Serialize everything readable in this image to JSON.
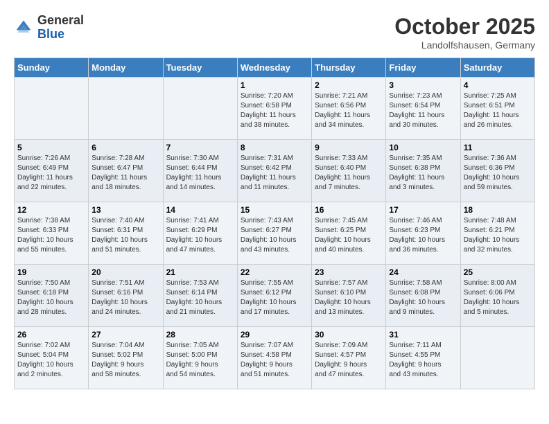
{
  "logo": {
    "general": "General",
    "blue": "Blue"
  },
  "header": {
    "month": "October 2025",
    "location": "Landolfshausen, Germany"
  },
  "weekdays": [
    "Sunday",
    "Monday",
    "Tuesday",
    "Wednesday",
    "Thursday",
    "Friday",
    "Saturday"
  ],
  "weeks": [
    [
      {
        "day": "",
        "info": ""
      },
      {
        "day": "",
        "info": ""
      },
      {
        "day": "",
        "info": ""
      },
      {
        "day": "1",
        "info": "Sunrise: 7:20 AM\nSunset: 6:58 PM\nDaylight: 11 hours\nand 38 minutes."
      },
      {
        "day": "2",
        "info": "Sunrise: 7:21 AM\nSunset: 6:56 PM\nDaylight: 11 hours\nand 34 minutes."
      },
      {
        "day": "3",
        "info": "Sunrise: 7:23 AM\nSunset: 6:54 PM\nDaylight: 11 hours\nand 30 minutes."
      },
      {
        "day": "4",
        "info": "Sunrise: 7:25 AM\nSunset: 6:51 PM\nDaylight: 11 hours\nand 26 minutes."
      }
    ],
    [
      {
        "day": "5",
        "info": "Sunrise: 7:26 AM\nSunset: 6:49 PM\nDaylight: 11 hours\nand 22 minutes."
      },
      {
        "day": "6",
        "info": "Sunrise: 7:28 AM\nSunset: 6:47 PM\nDaylight: 11 hours\nand 18 minutes."
      },
      {
        "day": "7",
        "info": "Sunrise: 7:30 AM\nSunset: 6:44 PM\nDaylight: 11 hours\nand 14 minutes."
      },
      {
        "day": "8",
        "info": "Sunrise: 7:31 AM\nSunset: 6:42 PM\nDaylight: 11 hours\nand 11 minutes."
      },
      {
        "day": "9",
        "info": "Sunrise: 7:33 AM\nSunset: 6:40 PM\nDaylight: 11 hours\nand 7 minutes."
      },
      {
        "day": "10",
        "info": "Sunrise: 7:35 AM\nSunset: 6:38 PM\nDaylight: 11 hours\nand 3 minutes."
      },
      {
        "day": "11",
        "info": "Sunrise: 7:36 AM\nSunset: 6:36 PM\nDaylight: 10 hours\nand 59 minutes."
      }
    ],
    [
      {
        "day": "12",
        "info": "Sunrise: 7:38 AM\nSunset: 6:33 PM\nDaylight: 10 hours\nand 55 minutes."
      },
      {
        "day": "13",
        "info": "Sunrise: 7:40 AM\nSunset: 6:31 PM\nDaylight: 10 hours\nand 51 minutes."
      },
      {
        "day": "14",
        "info": "Sunrise: 7:41 AM\nSunset: 6:29 PM\nDaylight: 10 hours\nand 47 minutes."
      },
      {
        "day": "15",
        "info": "Sunrise: 7:43 AM\nSunset: 6:27 PM\nDaylight: 10 hours\nand 43 minutes."
      },
      {
        "day": "16",
        "info": "Sunrise: 7:45 AM\nSunset: 6:25 PM\nDaylight: 10 hours\nand 40 minutes."
      },
      {
        "day": "17",
        "info": "Sunrise: 7:46 AM\nSunset: 6:23 PM\nDaylight: 10 hours\nand 36 minutes."
      },
      {
        "day": "18",
        "info": "Sunrise: 7:48 AM\nSunset: 6:21 PM\nDaylight: 10 hours\nand 32 minutes."
      }
    ],
    [
      {
        "day": "19",
        "info": "Sunrise: 7:50 AM\nSunset: 6:18 PM\nDaylight: 10 hours\nand 28 minutes."
      },
      {
        "day": "20",
        "info": "Sunrise: 7:51 AM\nSunset: 6:16 PM\nDaylight: 10 hours\nand 24 minutes."
      },
      {
        "day": "21",
        "info": "Sunrise: 7:53 AM\nSunset: 6:14 PM\nDaylight: 10 hours\nand 21 minutes."
      },
      {
        "day": "22",
        "info": "Sunrise: 7:55 AM\nSunset: 6:12 PM\nDaylight: 10 hours\nand 17 minutes."
      },
      {
        "day": "23",
        "info": "Sunrise: 7:57 AM\nSunset: 6:10 PM\nDaylight: 10 hours\nand 13 minutes."
      },
      {
        "day": "24",
        "info": "Sunrise: 7:58 AM\nSunset: 6:08 PM\nDaylight: 10 hours\nand 9 minutes."
      },
      {
        "day": "25",
        "info": "Sunrise: 8:00 AM\nSunset: 6:06 PM\nDaylight: 10 hours\nand 5 minutes."
      }
    ],
    [
      {
        "day": "26",
        "info": "Sunrise: 7:02 AM\nSunset: 5:04 PM\nDaylight: 10 hours\nand 2 minutes."
      },
      {
        "day": "27",
        "info": "Sunrise: 7:04 AM\nSunset: 5:02 PM\nDaylight: 9 hours\nand 58 minutes."
      },
      {
        "day": "28",
        "info": "Sunrise: 7:05 AM\nSunset: 5:00 PM\nDaylight: 9 hours\nand 54 minutes."
      },
      {
        "day": "29",
        "info": "Sunrise: 7:07 AM\nSunset: 4:58 PM\nDaylight: 9 hours\nand 51 minutes."
      },
      {
        "day": "30",
        "info": "Sunrise: 7:09 AM\nSunset: 4:57 PM\nDaylight: 9 hours\nand 47 minutes."
      },
      {
        "day": "31",
        "info": "Sunrise: 7:11 AM\nSunset: 4:55 PM\nDaylight: 9 hours\nand 43 minutes."
      },
      {
        "day": "",
        "info": ""
      }
    ]
  ]
}
